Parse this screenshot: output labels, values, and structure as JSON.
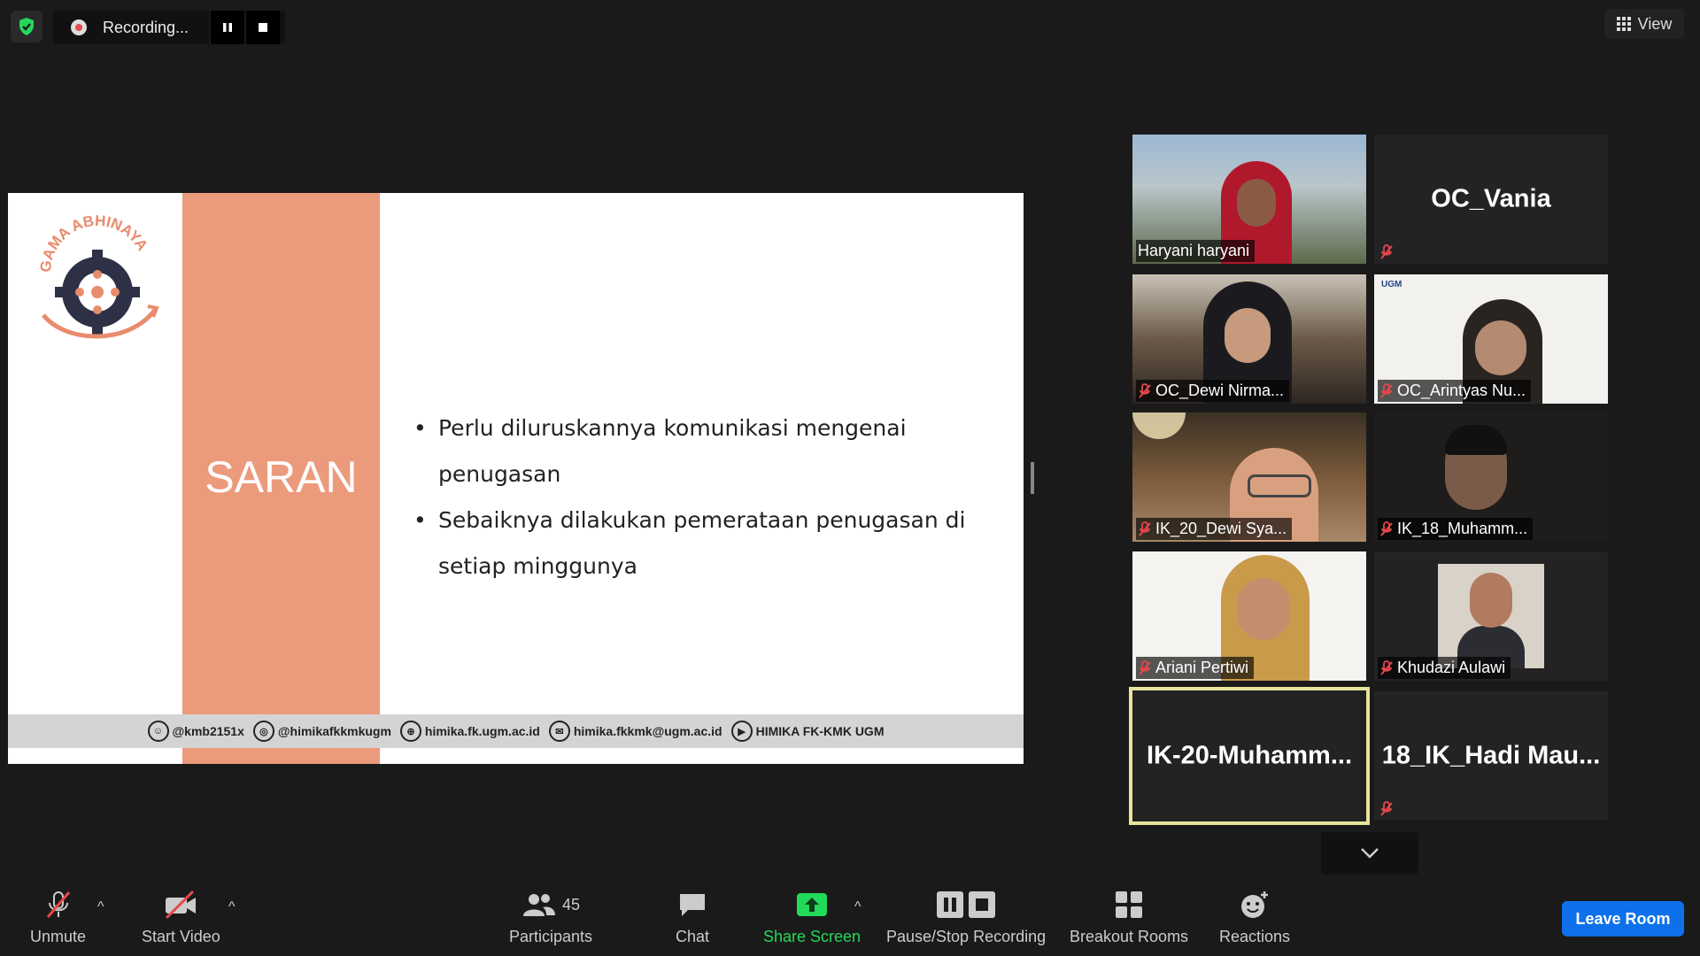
{
  "top": {
    "recording_label": "Recording...",
    "view_label": "View"
  },
  "slide": {
    "logo_text": "GAMA ABHINAYA",
    "title": "SARAN",
    "bullets": [
      "Perlu diluruskannya komunikasi mengenai penugasan",
      "Sebaiknya dilakukan pemerataan penugasan di setiap minggunya"
    ],
    "footer": [
      {
        "icon": "line-icon",
        "text": "@kmb2151x"
      },
      {
        "icon": "instagram-icon",
        "text": "@himikafkkmkugm"
      },
      {
        "icon": "globe-icon",
        "text": "himika.fk.ugm.ac.id"
      },
      {
        "icon": "mail-icon",
        "text": "himika.fkkmk@ugm.ac.id"
      },
      {
        "icon": "youtube-icon",
        "text": "HIMIKA FK-KMK UGM"
      }
    ]
  },
  "gallery": [
    {
      "name": "Haryani haryani",
      "muted": false,
      "video": true,
      "color": "#7a8a6a"
    },
    {
      "name": "OC_Vania",
      "muted": true,
      "video": false
    },
    {
      "name": "OC_Dewi Nirma...",
      "muted": true,
      "video": true,
      "color": "#6b5a48"
    },
    {
      "name": "OC_Arintyas Nu...",
      "muted": true,
      "video": true,
      "color": "#e8e6e2"
    },
    {
      "name": "IK_20_Dewi Sya...",
      "muted": true,
      "video": true,
      "color": "#8a6a4a"
    },
    {
      "name": "IK_18_Muhamm...",
      "muted": true,
      "video": true,
      "color": "#2a2626"
    },
    {
      "name": "Ariani Pertiwi",
      "muted": true,
      "video": true,
      "color": "#d8cfa8"
    },
    {
      "name": "Khudazi Aulawi",
      "muted": true,
      "video": true,
      "color": "#cfc9c0"
    },
    {
      "name": "IK-20-Muhamm...",
      "muted": false,
      "video": false,
      "active": true
    },
    {
      "name": "18_IK_Hadi  Mau...",
      "muted": true,
      "video": false
    }
  ],
  "toolbar": {
    "unmute": "Unmute",
    "start_video": "Start Video",
    "participants": "Participants",
    "participants_count": "45",
    "chat": "Chat",
    "share_screen": "Share Screen",
    "pause_stop": "Pause/Stop Recording",
    "breakout": "Breakout Rooms",
    "reactions": "Reactions",
    "leave": "Leave Room"
  },
  "colors": {
    "accent_band": "#ec9a7c",
    "share_green": "#23d959",
    "leave_blue": "#0e71eb",
    "active_speaker": "#e8e59a"
  }
}
